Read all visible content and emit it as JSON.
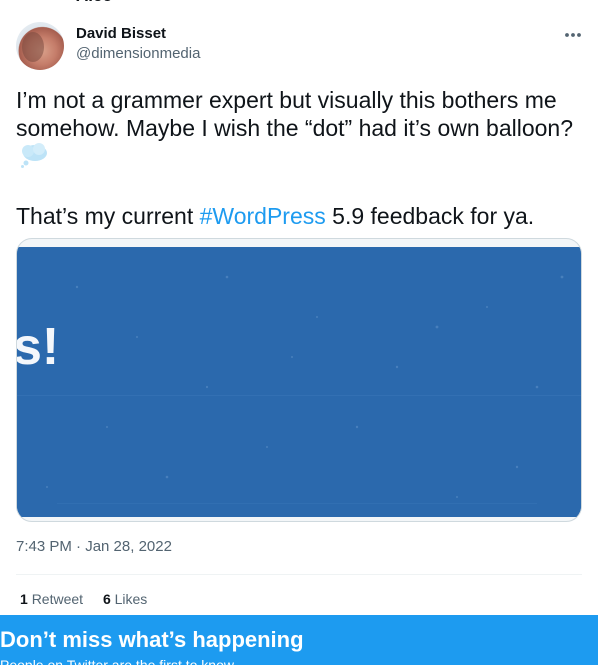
{
  "author": {
    "top_partial_text": "Ale...",
    "display_name": "David Bisset",
    "handle": "@dimensionmedia"
  },
  "tweet": {
    "line1": "I’m not a grammer expert but visually this bothers me somehow. Maybe I wish the “dot” had it’s own balloon?",
    "line2_prefix": "That’s my current ",
    "hashtag": "#WordPress",
    "line2_suffix": " 5.9 feedback for ya.",
    "balloon_emoji": "thought-balloon-icon"
  },
  "media": {
    "visible_glyph": "s!",
    "background_color": "#2b69ad"
  },
  "meta": {
    "timestamp": "7:43 PM · Jan 28, 2022"
  },
  "stats": {
    "retweets_count": "1",
    "retweets_label": "Retweet",
    "likes_count": "6",
    "likes_label": "Likes"
  },
  "banner": {
    "title": "Don’t miss what’s happening",
    "subtitle": "People on Twitter are the first to know.",
    "color": "#1d9bf0"
  },
  "colors": {
    "link": "#1d9bf0",
    "secondary_text": "#536471",
    "primary_text": "#0f1419"
  }
}
